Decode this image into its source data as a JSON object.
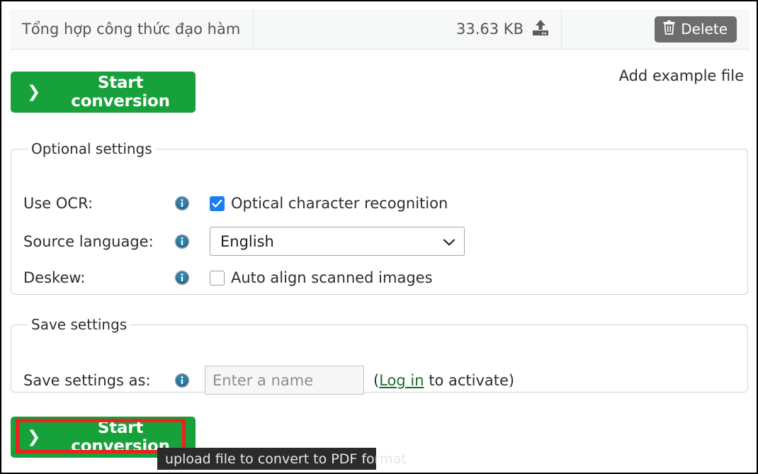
{
  "file_row": {
    "name": "Tổng hợp công thức đạo hàm",
    "size": "33.63 KB",
    "upload_icon": "upload-icon",
    "delete_label": "Delete",
    "delete_icon": "trash-icon"
  },
  "actions": {
    "start_conversion_label": "Start conversion",
    "chevron": "❯",
    "add_example_label": "Add example file"
  },
  "optional_settings": {
    "legend": "Optional settings",
    "rows": [
      {
        "label": "Use OCR:",
        "info_icon": "info-icon",
        "checkbox_label": "Optical character recognition",
        "checked": true
      },
      {
        "label": "Source language:",
        "info_icon": "info-icon",
        "select_value": "English",
        "select_chevron": "⌄"
      },
      {
        "label": "Deskew:",
        "info_icon": "info-icon",
        "checkbox_label": "Auto align scanned images",
        "checked": false
      }
    ]
  },
  "save_settings": {
    "legend": "Save settings",
    "label": "Save settings as:",
    "info_icon": "info-icon",
    "input_placeholder": "Enter a name",
    "input_value": "",
    "note_prefix": "(",
    "login_link": "Log in",
    "note_suffix": " to activate)"
  },
  "tooltip": {
    "text": "upload file to convert to PDF format"
  },
  "colors": {
    "green": "#17a13a",
    "delete_gray": "#6d6d6d",
    "checkbox_blue": "#1a7df0",
    "highlight_red": "#ef2020",
    "link_green": "#1d6b2a",
    "tooltip_bg": "#2b2b2b"
  }
}
